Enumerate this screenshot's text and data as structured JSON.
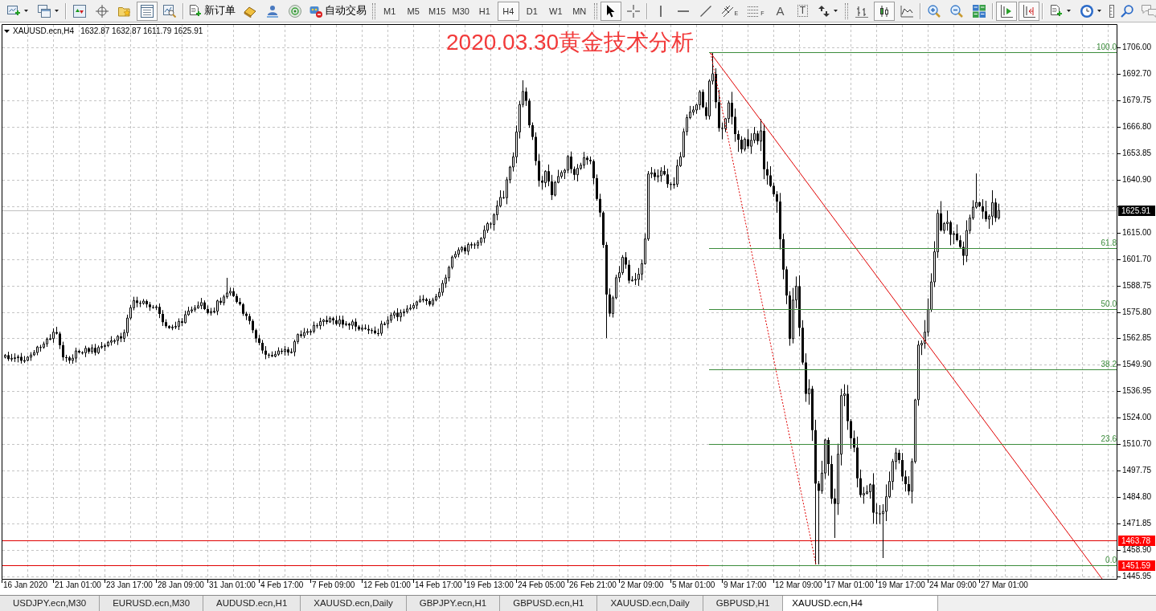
{
  "toolbar": {
    "bars": [
      {
        "sections": [
          [
            {
              "kind": "newchart",
              "selected": false,
              "dropdown": true
            },
            {
              "kind": "profiles",
              "selected": false,
              "dropdown": true
            }
          ],
          [
            {
              "kind": "marketwatch",
              "selected": false,
              "dropdown": false
            },
            {
              "kind": "datawindow",
              "selected": false,
              "dropdown": false
            },
            {
              "kind": "navigator",
              "selected": false,
              "dropdown": false
            },
            {
              "kind": "terminal",
              "selected": true,
              "dropdown": false
            },
            {
              "kind": "tester",
              "selected": false,
              "dropdown": false
            }
          ],
          [
            {
              "kind": "order",
              "label": "新订单",
              "selected": false,
              "dropdown": false
            },
            {
              "kind": "editor",
              "selected": false,
              "dropdown": false
            },
            {
              "kind": "signals",
              "selected": false,
              "dropdown": false
            },
            {
              "kind": "connection",
              "selected": false,
              "dropdown": false
            },
            {
              "kind": "autotrading",
              "label": "自动交易",
              "selected": false,
              "dropdown": false
            }
          ]
        ]
      },
      {
        "sections": [
          [
            {
              "kind": "timeframe",
              "label": "M1",
              "selected": false,
              "dropdown": false
            },
            {
              "kind": "timeframe",
              "label": "M5",
              "selected": false,
              "dropdown": false
            },
            {
              "kind": "timeframe",
              "label": "M15",
              "selected": false,
              "dropdown": false
            },
            {
              "kind": "timeframe",
              "label": "M30",
              "selected": false,
              "dropdown": false
            },
            {
              "kind": "timeframe",
              "label": "H1",
              "selected": false,
              "dropdown": false
            },
            {
              "kind": "timeframe",
              "label": "H4",
              "selected": true,
              "dropdown": false
            },
            {
              "kind": "timeframe",
              "label": "D1",
              "selected": false,
              "dropdown": false
            },
            {
              "kind": "timeframe",
              "label": "W1",
              "selected": false,
              "dropdown": false
            },
            {
              "kind": "timeframe",
              "label": "MN",
              "selected": false,
              "dropdown": false
            }
          ]
        ]
      },
      {
        "sections": [
          [
            {
              "kind": "cursor",
              "selected": true,
              "dropdown": false
            },
            {
              "kind": "crosshair",
              "selected": false,
              "dropdown": false
            }
          ],
          [
            {
              "kind": "vline",
              "selected": false,
              "dropdown": false
            },
            {
              "kind": "hline",
              "selected": false,
              "dropdown": false
            },
            {
              "kind": "trendline",
              "selected": false,
              "dropdown": false
            },
            {
              "kind": "channel",
              "label": "E",
              "selected": false,
              "dropdown": false
            },
            {
              "kind": "fibo",
              "label": "F",
              "selected": false,
              "dropdown": false
            },
            {
              "kind": "text",
              "label": "A",
              "selected": false,
              "dropdown": false
            },
            {
              "kind": "textlabel",
              "label": "T",
              "selected": false,
              "dropdown": false
            },
            {
              "kind": "arrows",
              "selected": false,
              "dropdown": true
            }
          ]
        ]
      },
      {
        "sections": [
          [
            {
              "kind": "barchart",
              "selected": false,
              "dropdown": false
            },
            {
              "kind": "candles",
              "selected": true,
              "dropdown": false
            },
            {
              "kind": "linechart",
              "selected": false,
              "dropdown": false
            }
          ],
          [
            {
              "kind": "zoomin",
              "selected": false,
              "dropdown": false
            },
            {
              "kind": "zoomout",
              "selected": false,
              "dropdown": false
            },
            {
              "kind": "tile",
              "selected": false,
              "dropdown": false
            }
          ],
          [
            {
              "kind": "autoscroll",
              "selected": true,
              "dropdown": false
            },
            {
              "kind": "shift",
              "selected": true,
              "dropdown": false
            }
          ],
          [
            {
              "kind": "indicators",
              "selected": false,
              "dropdown": true
            },
            {
              "kind": "periods",
              "selected": false,
              "dropdown": true
            },
            {
              "kind": "templates",
              "selected": false,
              "dropdown": false
            },
            {
              "kind": "search",
              "selected": false,
              "dropdown": false
            },
            {
              "kind": "chat",
              "selected": false,
              "dropdown": false
            }
          ]
        ]
      }
    ]
  },
  "chart": {
    "header": {
      "symbol": "XAUUSD.ecn,H4",
      "ohlc": "1632.87 1632.87 1611.79 1625.91"
    },
    "title": "2020.03.30黄金技术分析",
    "price_axis": [
      "1706.00",
      "1692.70",
      "1679.75",
      "1666.80",
      "1653.85",
      "1640.90",
      "1615.00",
      "1601.70",
      "1588.75",
      "1575.80",
      "1562.85",
      "1549.90",
      "1536.95",
      "1524.00",
      "1510.70",
      "1497.75",
      "1484.80",
      "1471.85",
      "1458.90",
      "1445.95"
    ],
    "time_axis": [
      "16 Jan 2020",
      "21 Jan 01:00",
      "23 Jan 17:00",
      "28 Jan 09:00",
      "31 Jan 01:00",
      "4 Feb 17:00",
      "7 Feb 09:00",
      "12 Feb 01:00",
      "14 Feb 17:00",
      "19 Feb 13:00",
      "24 Feb 05:00",
      "26 Feb 21:00",
      "2 Mar 09:00",
      "5 Mar 01:00",
      "9 Mar 17:00",
      "12 Mar 09:00",
      "17 Mar 01:00",
      "19 Mar 17:00",
      "24 Mar 09:00",
      "27 Mar 01:00"
    ],
    "fibonacci_levels": [
      "100.0",
      "61.8",
      "50.0",
      "38.2",
      "23.6",
      "0.0"
    ],
    "price_markers": [
      {
        "kind": "bid",
        "text": "1625.91"
      },
      {
        "kind": "line",
        "text": "1463.78"
      },
      {
        "kind": "line",
        "text": "1451.59"
      }
    ]
  },
  "tabs": [
    {
      "label": "USDJPY.ecn,M30",
      "selected": false
    },
    {
      "label": "EURUSD.ecn,M30",
      "selected": false
    },
    {
      "label": "AUDUSD.ecn,H1",
      "selected": false
    },
    {
      "label": "XAUUSD.ecn,Daily",
      "selected": false
    },
    {
      "label": "GBPJPY.ecn,H1",
      "selected": false
    },
    {
      "label": "GBPUSD.ecn,H1",
      "selected": false
    },
    {
      "label": "XAUUSD.ecn,Daily",
      "selected": false
    },
    {
      "label": "GBPUSD,H1",
      "selected": false
    },
    {
      "label": "XAUUSD.ecn,H4",
      "selected": true
    }
  ]
}
